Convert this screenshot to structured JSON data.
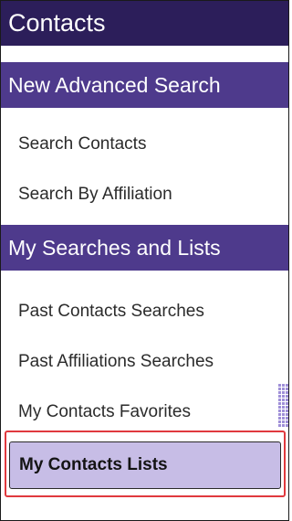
{
  "panel": {
    "title": "Contacts"
  },
  "sections": [
    {
      "header": "New Advanced Search",
      "items": [
        "Search Contacts",
        "Search By Affiliation"
      ]
    },
    {
      "header": "My Searches and Lists",
      "items": [
        "Past Contacts Searches",
        "Past Affiliations Searches",
        "My Contacts Favorites"
      ]
    }
  ],
  "selected_item": "My Contacts Lists",
  "colors": {
    "title_bg": "#2c1e5a",
    "section_bg": "#4e3a8c",
    "selected_bg": "#c7bde6",
    "highlight_border": "#e0393e"
  },
  "icons": {
    "grid": "grid-pattern-icon"
  }
}
